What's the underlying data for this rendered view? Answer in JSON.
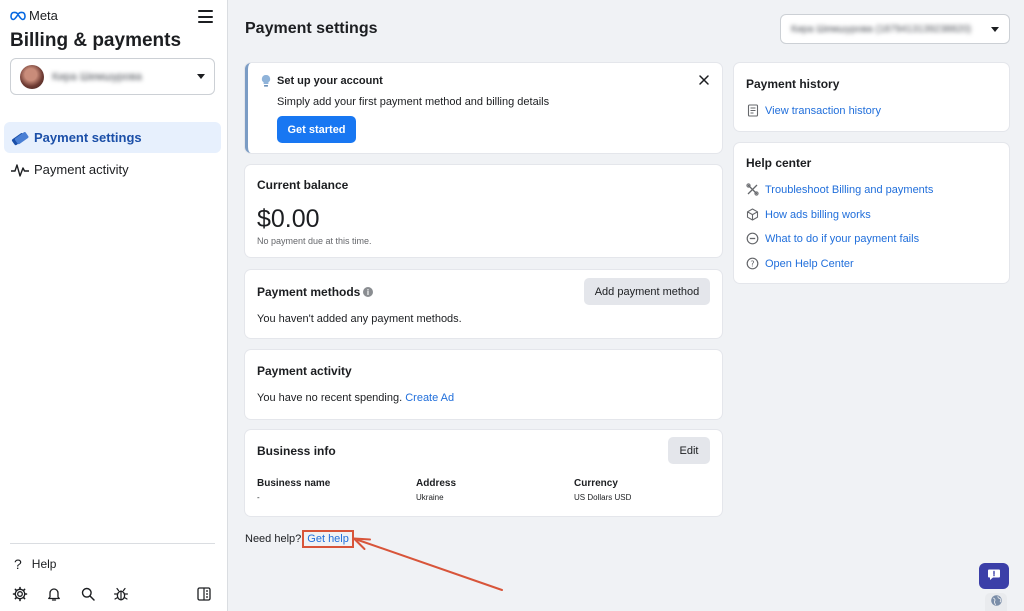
{
  "sidebar": {
    "brand": "Meta",
    "title": "Billing & payments",
    "account_name": "Кира Шемшурова",
    "nav": [
      {
        "label": "Payment settings",
        "icon": "credit-card-icon",
        "active": true
      },
      {
        "label": "Payment activity",
        "icon": "pulse-icon",
        "active": false
      }
    ],
    "help_label": "Help",
    "bottom_icons": [
      "gear-icon",
      "bell-icon",
      "search-icon",
      "bug-icon",
      "panel-toggle-icon"
    ]
  },
  "header": {
    "title": "Payment settings",
    "account_selector": "Кира Шемшурова (1879413139238820)"
  },
  "setup_card": {
    "title": "Set up your account",
    "description": "Simply add your first payment method and billing details",
    "button": "Get started"
  },
  "balance_card": {
    "title": "Current balance",
    "amount": "$0.00",
    "note": "No payment due at this time."
  },
  "methods_card": {
    "title": "Payment methods",
    "button": "Add payment method",
    "body": "You haven't added any payment methods."
  },
  "activity_card": {
    "title": "Payment activity",
    "body": "You have no recent spending.",
    "link": "Create Ad"
  },
  "business_card": {
    "title": "Business info",
    "button": "Edit",
    "fields": [
      {
        "label": "Business name",
        "value": "-"
      },
      {
        "label": "Address",
        "value": "Ukraine"
      },
      {
        "label": "Currency",
        "value": "US Dollars USD"
      }
    ]
  },
  "footer": {
    "need_help": "Need help?",
    "get_help": "Get help"
  },
  "history_card": {
    "title": "Payment history",
    "link": "View transaction history"
  },
  "help_center": {
    "title": "Help center",
    "links": [
      {
        "label": "Troubleshoot Billing and payments",
        "icon": "tools-icon"
      },
      {
        "label": "How ads billing works",
        "icon": "cube-icon"
      },
      {
        "label": "What to do if your payment fails",
        "icon": "minus-circle-icon"
      },
      {
        "label": "Open Help Center",
        "icon": "question-circle-icon"
      }
    ]
  },
  "colors": {
    "accent": "#1877f2",
    "link": "#216fdb",
    "annotation": "#d8553a",
    "chat": "#3b3fa8"
  }
}
